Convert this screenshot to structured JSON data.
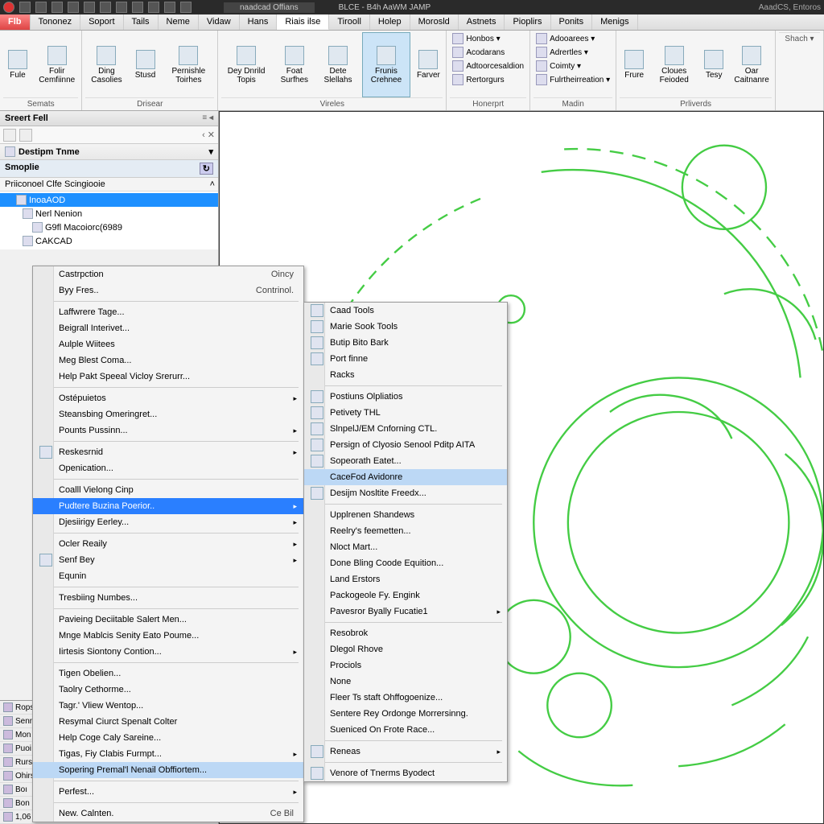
{
  "titlebar": {
    "doc": "naadcad Offians",
    "app": "BLCE - B4h AaWM JAMP",
    "right": "AaadCS, Entoros"
  },
  "menu": {
    "file": "Flb",
    "tabs": [
      "Tononez",
      "Soport",
      "Tails",
      "Neme",
      "Vidaw",
      "Hans",
      "Riais ilse",
      "Tirooll",
      "Holep",
      "Morosld",
      "Astnets",
      "Pioplirs",
      "Ponits",
      "Menigs"
    ],
    "activeIdx": "6"
  },
  "ribbon": {
    "groups": [
      {
        "label": "Semats",
        "btns": [
          {
            "t": "Fule"
          },
          {
            "t": "Folir Cemfiinne"
          }
        ]
      },
      {
        "label": "Drisear",
        "btns": [
          {
            "t": "Ding Casolies"
          },
          {
            "t": "Stusd"
          },
          {
            "t": "Pernishle Toirhes"
          }
        ]
      },
      {
        "label": "Vireles",
        "btns": [
          {
            "t": "Dey Dnrild Topis"
          },
          {
            "t": "Foat Surfhes"
          },
          {
            "t": "Dete Slellahs"
          },
          {
            "t": "Frunis Crehnee",
            "active": true
          },
          {
            "t": "Farver"
          }
        ]
      },
      {
        "label": "Honerprt",
        "rows": [
          "Honbos ▾",
          "Acodarans",
          "Adtoorcesaldion",
          "Rertorgurs"
        ]
      },
      {
        "label": "Madin",
        "rows": [
          "Adooarees ▾",
          "Adrertles ▾",
          "Coimty ▾",
          "Fulrtheirreation ▾"
        ]
      },
      {
        "label": "Prliverds",
        "btns": [
          {
            "t": "Frure"
          },
          {
            "t": "Cloues Feioded"
          },
          {
            "t": "Tesy"
          },
          {
            "t": "Oar Caitnanre"
          }
        ]
      }
    ],
    "shach": "Shach ▾"
  },
  "panel": {
    "title": "Sreert Fell",
    "section1": "Destipm Tnme",
    "smoplie": "Smoplie",
    "sub": "Priiconoel Clfe Scingiooie",
    "tree": [
      {
        "t": "InoaAOD",
        "sel": true,
        "lvl": 0
      },
      {
        "t": "Nerl Nenion",
        "lvl": 1
      },
      {
        "t": "G9fl Macoiorc(6989",
        "lvl": 2
      },
      {
        "t": "CAKCAD",
        "lvl": 1
      }
    ],
    "bottomRows": [
      "Rops",
      "Senn",
      "Mon",
      "Puoi",
      "Rurs",
      "Ohirs",
      "Boı",
      "Bon",
      "1,06"
    ]
  },
  "ctx1": {
    "groups": [
      [
        {
          "t": "Castrpction",
          "rt": "Oincy"
        },
        {
          "t": "Byy Fres..",
          "rt": "Contrinol."
        }
      ],
      [
        {
          "t": "Laffwrere Tage..."
        },
        {
          "t": "Beigrall Interivet..."
        },
        {
          "t": "Aulple Wiitees"
        },
        {
          "t": "Meg Blest Coma..."
        },
        {
          "t": "Help Pakt Speeal Vicloy Srerurr..."
        }
      ],
      [
        {
          "t": "Ostépuietos",
          "arr": true
        },
        {
          "t": "Steansbing Omeringret..."
        },
        {
          "t": "Pounts Pussinn...",
          "arr": true
        }
      ],
      [
        {
          "t": "Reskesrnid",
          "arr": true,
          "icon": true
        },
        {
          "t": "Openication..."
        }
      ],
      [
        {
          "t": "Coalll Vielong Cinp"
        },
        {
          "t": "Pudtere Buzina Poerior..",
          "hl": true,
          "arr": true
        },
        {
          "t": "Djesiirigy Eerley...",
          "arr": true
        }
      ],
      [
        {
          "t": "Ocler Reaily",
          "arr": true
        },
        {
          "t": "Senf Bey",
          "arr": true,
          "icon": true
        },
        {
          "t": "Equnin"
        }
      ],
      [
        {
          "t": "Tresbiing Numbes..."
        }
      ],
      [
        {
          "t": "Pavieing Deciitable Salert Men..."
        },
        {
          "t": "Mnge Mablcis Senity Eato Poume..."
        },
        {
          "t": "Iirtesis Siontony Contion...",
          "arr": true
        }
      ],
      [
        {
          "t": "Tigen Obelien..."
        },
        {
          "t": "Taolry Cethorme..."
        },
        {
          "t": "Tagr.' Vliew Wentop..."
        },
        {
          "t": "Resymal Ciurct Spenalt Colter"
        },
        {
          "t": "Help Coge Caly Sareine..."
        },
        {
          "t": "Tigas, Fiy Clabis Furmpt...",
          "arr": true
        },
        {
          "t": "Sopering Premal'l Nenail Obffiortem...",
          "hl2": true
        }
      ],
      [
        {
          "t": "Perfest...",
          "arr": true
        }
      ],
      [
        {
          "t": "New. Calnten.",
          "rt": "Ce Bil"
        }
      ]
    ]
  },
  "ctx2": {
    "groups": [
      [
        {
          "t": "Caad Tools",
          "icon": true
        },
        {
          "t": "Marie Sook Tools",
          "icon": true
        },
        {
          "t": "Butip Bito Bark",
          "icon": true
        },
        {
          "t": "Port finne",
          "icon": true
        },
        {
          "t": "Racks"
        }
      ],
      [
        {
          "t": "Postiuns Olpliatios",
          "icon": true
        },
        {
          "t": "Petivety THL",
          "icon": true
        },
        {
          "t": "SlnpelJ/EM Cnforning CTL.",
          "icon": true
        },
        {
          "t": "Persign of Clyosio Senool Pditp AITA",
          "icon": true
        },
        {
          "t": "Sopeorath Eatet...",
          "icon": true
        },
        {
          "t": "CaceFod Avidonre",
          "hl2": true
        },
        {
          "t": "Desijm Nosltite Freedx...",
          "icon": true
        }
      ],
      [
        {
          "t": "Upplrenen Shandews"
        },
        {
          "t": "Reelry's feemetten..."
        },
        {
          "t": "Nloct Mart..."
        },
        {
          "t": "Done Bling Coode Equition..."
        },
        {
          "t": "Land Erstors"
        },
        {
          "t": "Packogeole Fy. Engink"
        },
        {
          "t": "Pavesror Byally Fucatie1",
          "arr": true
        }
      ],
      [
        {
          "t": "Resobrok"
        },
        {
          "t": "Dlegol Rhove"
        },
        {
          "t": "Prociols"
        },
        {
          "t": "None"
        },
        {
          "t": "Fleer Ts staft Ohffogoenize..."
        },
        {
          "t": "Sentere Rey Ordonge Morrersinng."
        },
        {
          "t": "Sueniced On Frote Race..."
        }
      ],
      [
        {
          "t": "Reneas",
          "arr": true,
          "icon": true
        }
      ],
      [
        {
          "t": "Venore of Tnerms Byodect",
          "icon": true
        }
      ]
    ]
  }
}
